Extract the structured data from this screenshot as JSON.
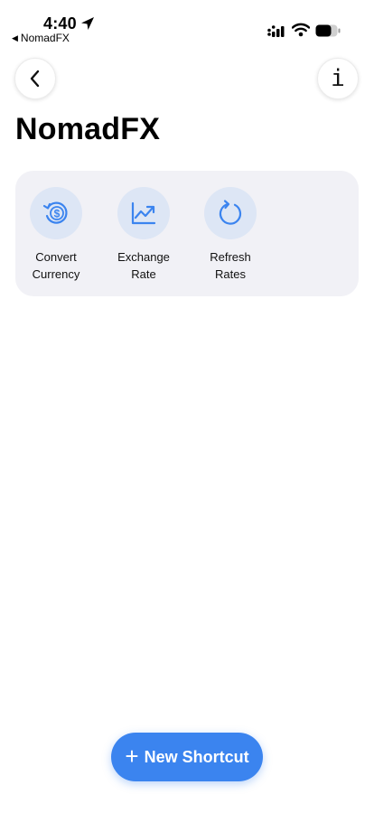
{
  "status_bar": {
    "time": "4:40",
    "back_app_label": "NomadFX",
    "icons": [
      "location-arrow-icon",
      "cellular-signal-icon",
      "wifi-icon",
      "battery-icon"
    ]
  },
  "nav": {
    "back_icon": "chevron-left-icon",
    "info_icon": "info-icon",
    "info_glyph": "i"
  },
  "page": {
    "title": "NomadFX"
  },
  "shortcuts": [
    {
      "icon": "currency-convert-icon",
      "line1": "Convert",
      "line2": "Currency"
    },
    {
      "icon": "chart-trend-icon",
      "line1": "Exchange",
      "line2": "Rate"
    },
    {
      "icon": "refresh-icon",
      "line1": "Refresh",
      "line2": "Rates"
    }
  ],
  "new_shortcut": {
    "label": "New Shortcut",
    "icon": "plus-icon"
  },
  "colors": {
    "accent": "#3b84ef",
    "tile_bg": "#dde6f5",
    "card_bg": "#f1f1f6"
  }
}
